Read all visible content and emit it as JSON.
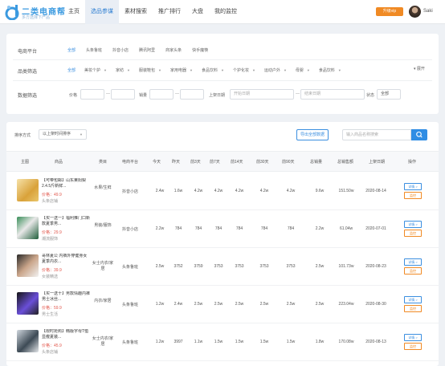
{
  "brand": {
    "name": "二类电商帮",
    "slogan": "多方选择下产品"
  },
  "nav": [
    "主页",
    "选品参谋",
    "素材搜索",
    "推广排行",
    "大盘",
    "我的监控"
  ],
  "user": {
    "vip_label": "升级vip",
    "name": "Saki"
  },
  "filters": {
    "platform": {
      "label": "电商平台",
      "options": [
        "全部",
        "头条鲁班",
        "抖音小店",
        "腾讯阿里",
        "商家头条",
        "快手魔筷"
      ]
    },
    "category": {
      "label": "品类筛选",
      "options": [
        "全部",
        "美妆个护",
        "家纺",
        "服装鞋包",
        "家用电器",
        "食品饮料",
        "个护化妆",
        "运动户外",
        "母婴",
        "食品饮料"
      ],
      "expand": "展开"
    },
    "range": {
      "label": "数据筛选",
      "price_label": "价格",
      "sales_label": "销量",
      "date_label": "上架日期",
      "start_placeholder": "开始日期",
      "end_placeholder": "结束日期",
      "status_label": "状态",
      "status_value": "全部",
      "dash": "—"
    }
  },
  "toolbar": {
    "sort_label": "排序方式",
    "sort_value": "以上架时间排序",
    "data_button": "导出全部数据",
    "search_placeholder": "输入商品名称搜索",
    "search_icon": "search-icon"
  },
  "table": {
    "headers": [
      "主图",
      "商品",
      "类目",
      "电商平台",
      "今天",
      "昨天",
      "前3天",
      "前7天",
      "前14天",
      "前30天",
      "前90天",
      "总销量",
      "总销售额",
      "上架日期",
      "操作"
    ],
    "actions": [
      "详情 >",
      "监控"
    ],
    "rows": [
      {
        "name": "【可带包邮】山东莱阳梨2.4.5斤新鲜...",
        "tag": "价格：49.9",
        "shop": "头条店铺",
        "category": "水果/生鲜",
        "platform": "抖音小店",
        "values": [
          "2.4w",
          "1.6w",
          "4.2w",
          "4.2w",
          "4.2w",
          "4.2w",
          "4.2w",
          "9.6w"
        ],
        "gmv": "151.50w",
        "date": "2020-08-14"
      },
      {
        "name": "【买一送一】福利推门口新款夏季男...",
        "tag": "价格：29.9",
        "shop": "潮流服饰",
        "category": "男装/服饰",
        "platform": "抖音小店",
        "values": [
          "2.2w",
          "784",
          "784",
          "784",
          "784",
          "784",
          "784",
          "2.2w"
        ],
        "gmv": "61.04w",
        "date": "2020-07-01"
      },
      {
        "name": "哥林夏公 内裤外穿健身女 夏季内衣...",
        "tag": "价格：39.9",
        "shop": "女装精选",
        "category": "女士内衣/家居",
        "platform": "头条鲁班",
        "values": [
          "2.5w",
          "3752",
          "3759",
          "3753",
          "3753",
          "3753",
          "3753",
          "2.5w"
        ],
        "gmv": "101.73w",
        "date": "2020-08-23"
      },
      {
        "name": "【买一送十】男款情趣内裤男士冰丝...",
        "tag": "价格：59.9",
        "shop": "男士生活",
        "category": "内衣/家居",
        "platform": "头条鲁班",
        "values": [
          "1.2w",
          "2.4w",
          "2.5w",
          "2.5w",
          "2.5w",
          "2.5w",
          "2.5w",
          "2.5w"
        ],
        "gmv": "223.04w",
        "date": "2020-08-30"
      },
      {
        "name": "【限时抢购】韩版字母T恤显瘦夏装...",
        "tag": "价格：45.9",
        "shop": "头条店铺",
        "category": "女士内衣/家居",
        "platform": "头条鲁班",
        "values": [
          "1.2w",
          "3997",
          "1.1w",
          "1.5w",
          "1.5w",
          "1.5w",
          "1.5w",
          "1.8w"
        ],
        "gmv": "170.08w",
        "date": "2020-08-13"
      }
    ]
  },
  "colors": {
    "accent": "#2f8de4",
    "orange": "#f08a24",
    "price_red": "#e2574c"
  }
}
